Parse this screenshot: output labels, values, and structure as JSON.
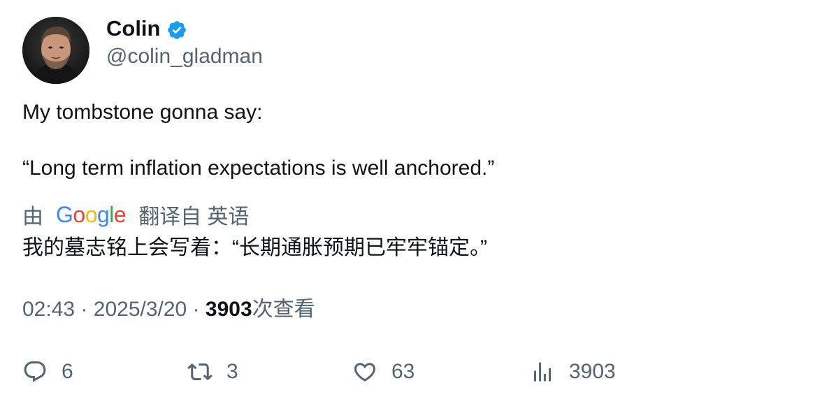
{
  "author": {
    "display_name": "Colin",
    "handle": "@colin_gladman",
    "verified": true,
    "verified_color": "#1D9BF0"
  },
  "tweet": {
    "line1": "My tombstone gonna say:",
    "line2": "“Long term inflation expectations is well anchored.”"
  },
  "translation": {
    "prefix": "由",
    "provider": "Google",
    "suffix": "翻译自 英语",
    "text": "我的墓志铭上会写着：“长期通胀预期已牢牢锚定。”"
  },
  "meta": {
    "time": "02:43",
    "separator": "·",
    "date": "2025/3/20",
    "views": "3903",
    "views_label": "次查看"
  },
  "actions": {
    "reply_icon": "reply-icon",
    "replies": "6",
    "retweet_icon": "retweet-icon",
    "retweets": "3",
    "like_icon": "heart-icon",
    "likes": "63",
    "views_icon": "bar-chart-icon",
    "views": "3903"
  },
  "colors": {
    "text_primary": "#0f1419",
    "text_secondary": "#536471"
  }
}
